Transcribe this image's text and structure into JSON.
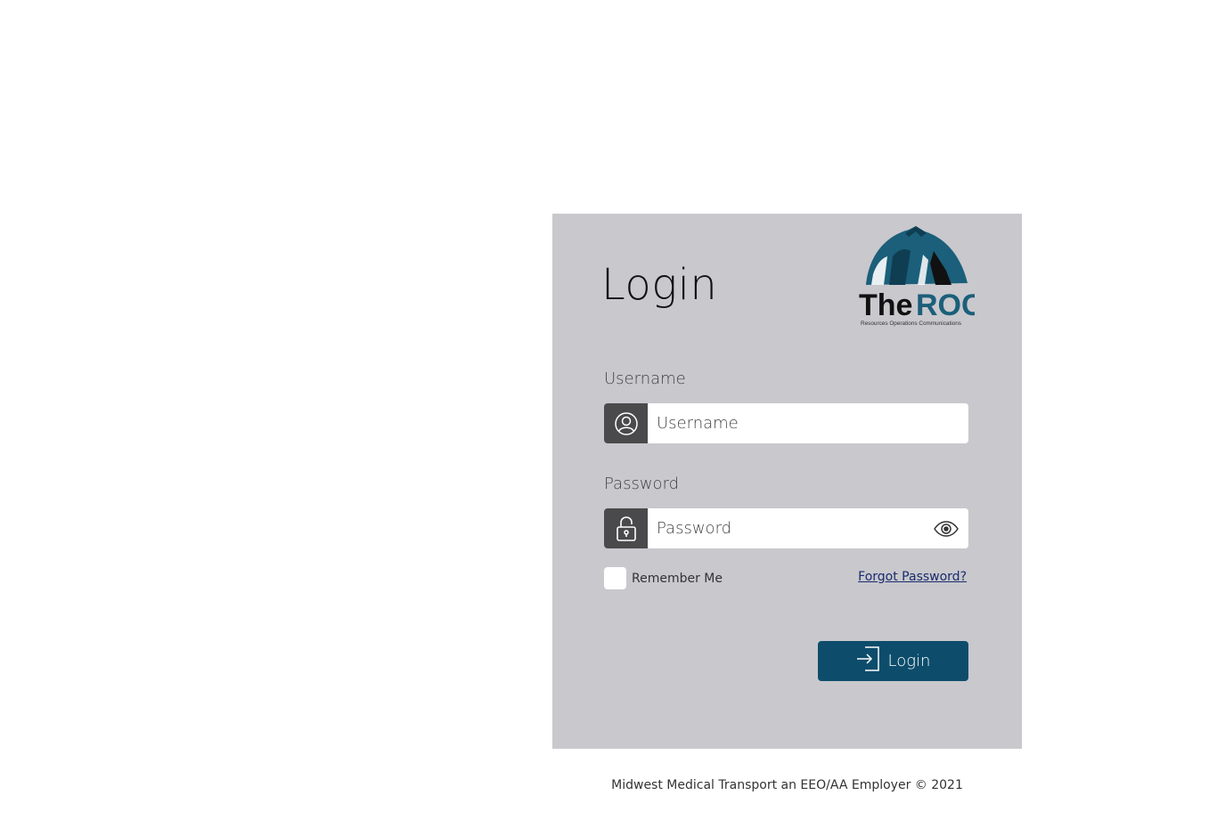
{
  "login_panel": {
    "title": "Login",
    "logo": {
      "name": "the-roc-logo",
      "text_primary": "The",
      "text_secondary": "ROC",
      "tagline": "Resources Operations Communications",
      "colors": {
        "teal": "#1b5f7a",
        "dark": "#111111"
      }
    },
    "username": {
      "label": "Username",
      "placeholder": "Username",
      "value": "",
      "icon": "user-icon"
    },
    "password": {
      "label": "Password",
      "placeholder": "Password",
      "value": "",
      "icon": "lock-icon",
      "toggle_icon": "eye-icon"
    },
    "remember_me": {
      "label": "Remember Me",
      "checked": false
    },
    "forgot_password": "Forgot Password?",
    "login_button": {
      "label": "Login",
      "icon": "sign-in-icon"
    }
  },
  "footer": {
    "text": "Midwest Medical Transport an EEO/AA Employer © 2021"
  },
  "colors": {
    "panel_bg": "#c8c8cd",
    "icon_bg": "#4a4a4c",
    "button_bg": "#0d4d6b",
    "link": "#1a2a6c"
  }
}
